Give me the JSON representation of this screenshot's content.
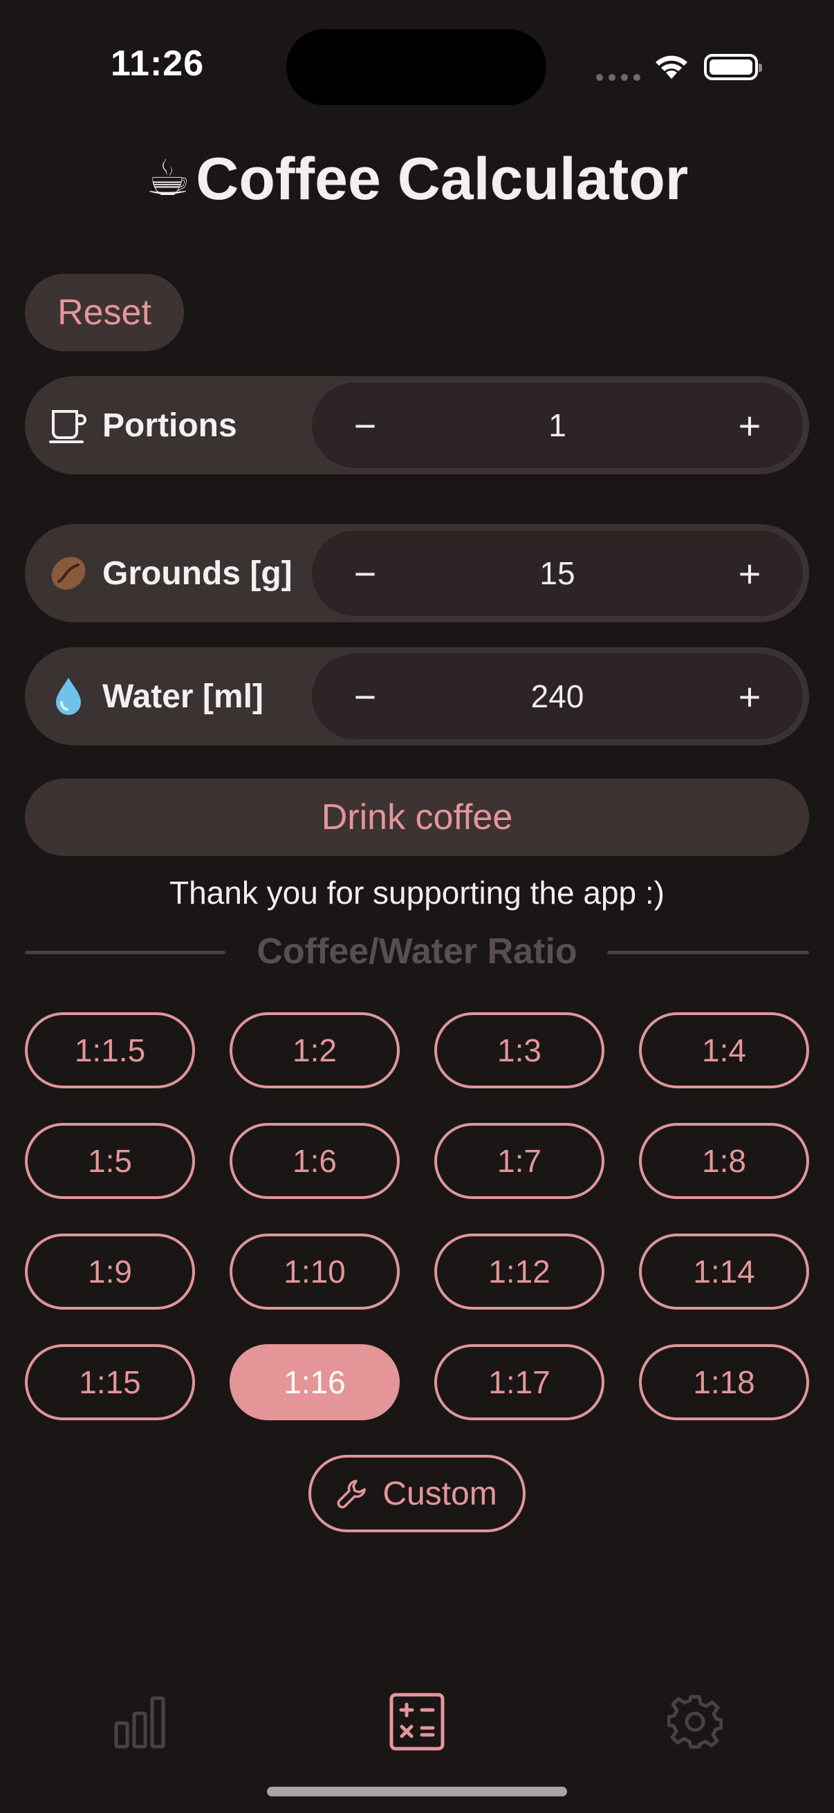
{
  "status_bar": {
    "time": "11:26"
  },
  "header": {
    "title_emoji": "☕",
    "title": "Coffee Calculator"
  },
  "actions": {
    "reset_label": "Reset",
    "drink_label": "Drink coffee"
  },
  "controls": {
    "portions": {
      "label": "Portions",
      "value": "1",
      "minus": "−",
      "plus": "+"
    },
    "grounds": {
      "label": "Grounds [g]",
      "value": "15",
      "minus": "−",
      "plus": "+"
    },
    "water": {
      "label": "Water [ml]",
      "value": "240",
      "minus": "−",
      "plus": "+"
    }
  },
  "thanks_text": "Thank you for supporting the app :)",
  "ratio": {
    "section_title": "Coffee/Water Ratio",
    "options": [
      "1:1.5",
      "1:2",
      "1:3",
      "1:4",
      "1:5",
      "1:6",
      "1:7",
      "1:8",
      "1:9",
      "1:10",
      "1:12",
      "1:14",
      "1:15",
      "1:16",
      "1:17",
      "1:18"
    ],
    "selected": "1:16",
    "custom_label": "Custom"
  },
  "tab_bar": {
    "tabs": [
      {
        "icon": "bar-chart-icon",
        "active": false
      },
      {
        "icon": "calculator-icon",
        "active": true
      },
      {
        "icon": "gear-icon",
        "active": false
      }
    ]
  },
  "colors": {
    "background": "#1a1616",
    "accent": "#e5969a",
    "surface": "#3b3232",
    "stepper": "#2d2525",
    "muted": "#5a4f4f"
  }
}
